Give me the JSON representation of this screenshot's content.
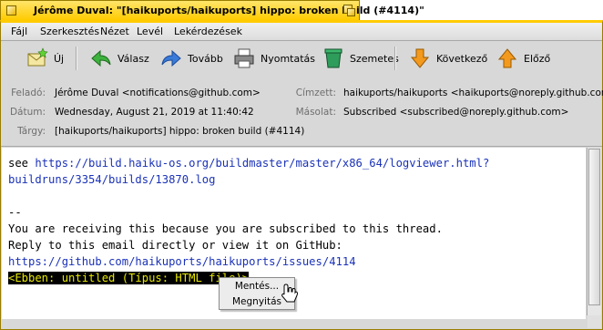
{
  "window": {
    "title": "Jérôme Duval: \"[haikuports/haikuports] hippo: broken build (#4114)\""
  },
  "menubar": [
    "Fájl",
    "Szerkesztés",
    "Nézet",
    "Levél",
    "Lekérdezések"
  ],
  "toolbar": {
    "new": "Új",
    "reply": "Válasz",
    "forward": "Tovább",
    "print": "Nyomtatás",
    "trash": "Szemetes",
    "next": "Következő",
    "prev": "Előző"
  },
  "headers": {
    "from_label": "Feladó:",
    "from": "Jérôme Duval <notifications@github.com>",
    "date_label": "Dátum:",
    "date": "Wednesday, August 21, 2019 at 11:40:42",
    "subject_label": "Tárgy:",
    "subject": "[haikuports/haikuports] hippo: broken build (#4114)",
    "to_label": "Címzett:",
    "to": "haikuports/haikuports <haikuports@noreply.github.com>",
    "cc_label": "Másolat:",
    "cc": "Subscribed <subscribed@noreply.github.com>"
  },
  "body": {
    "line1_prefix": "see ",
    "link1_a": "https://build.haiku-os.org/buildmaster/master/x86_64/logviewer.html?",
    "link1_b": "buildruns/3354/builds/13870.log",
    "sig": "--",
    "l_sub": "You are receiving this because you are subscribed to this thread.",
    "l_reply": "Reply to this email directly or view it on GitHub:",
    "link2": "https://github.com/haikuports/haikuports/issues/4114",
    "attachment": "<Ebben: untitled (Típus: HTML file)>"
  },
  "popup": {
    "save": "Mentés...",
    "open": "Megnyitás"
  },
  "colors": {
    "tab": "#ffcb00",
    "link": "#1a32b8",
    "attachment_fg": "#e8e800"
  }
}
